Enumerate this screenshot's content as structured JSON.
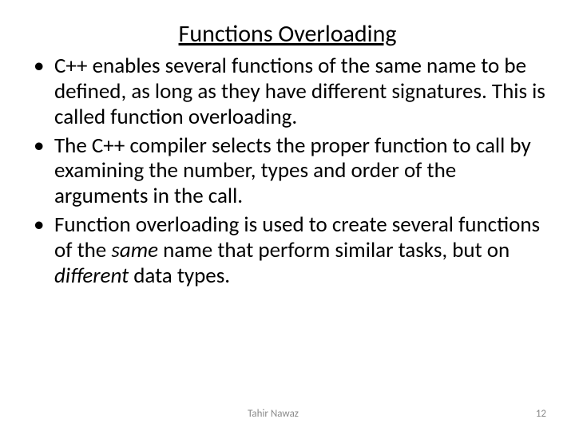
{
  "title": "Functions Overloading",
  "bullets": [
    {
      "pre": "C++ enables several functions of the same name to be defined, as long as they have different signatures. This is called function overloading."
    },
    {
      "pre": "The C++ compiler selects the proper function to call by examining the number, types and order of the arguments in the call."
    },
    {
      "pre": "Function overloading is used to create several functions of the ",
      "em1": "same",
      "mid": " name that perform similar tasks, but on ",
      "em2": "different",
      "post": " data types."
    }
  ],
  "footer": {
    "author": "Tahir Nawaz",
    "page": "12"
  }
}
